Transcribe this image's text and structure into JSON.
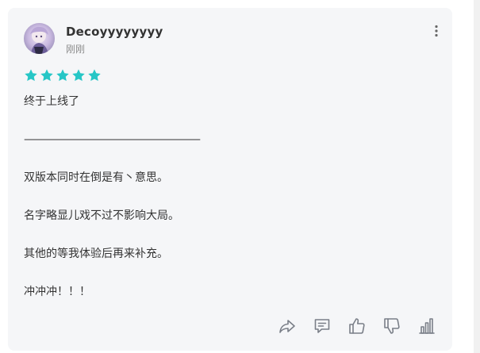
{
  "review": {
    "username": "Decoyyyyyyyy",
    "time": "刚刚",
    "rating": 5,
    "star_color": "#26c6c6",
    "paragraphs": [
      "终于上线了",
      "————————————————————",
      "双版本同时在倒是有丶意思。",
      "名字略显儿戏不过不影响大局。",
      "其他的等我体验后再来补充。",
      "冲冲冲！！！"
    ]
  },
  "icons": {
    "more": "more-vertical-icon",
    "share": "share-icon",
    "comment": "comment-icon",
    "like": "thumbs-up-icon",
    "dislike": "thumbs-down-icon",
    "stats": "bar-chart-icon"
  }
}
